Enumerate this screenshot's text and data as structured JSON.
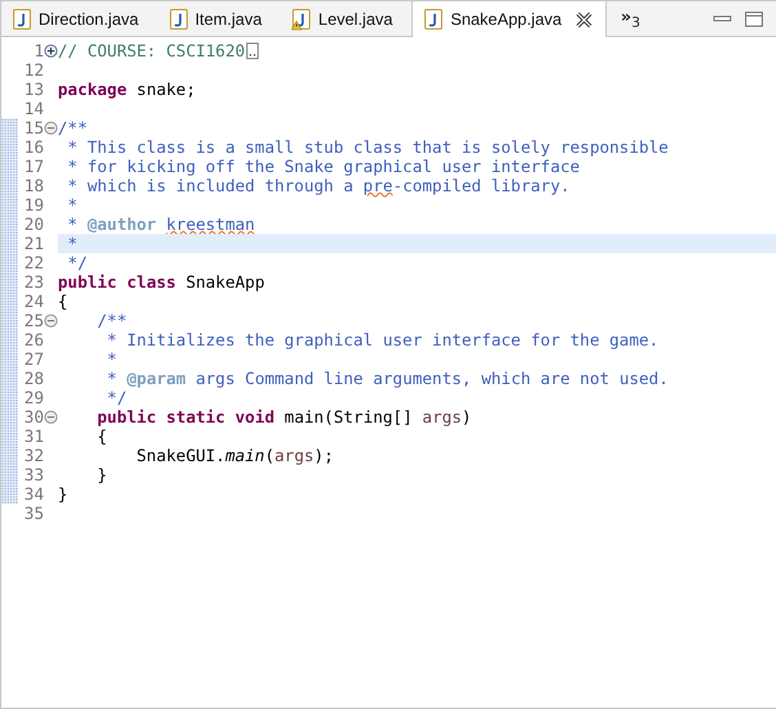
{
  "tabs": [
    {
      "label": "Direction.java",
      "selected": false,
      "warning": false,
      "closable": false
    },
    {
      "label": "Item.java",
      "selected": false,
      "warning": false,
      "closable": false
    },
    {
      "label": "Level.java",
      "selected": false,
      "warning": true,
      "closable": false
    },
    {
      "label": "SnakeApp.java",
      "selected": true,
      "warning": false,
      "closable": true
    }
  ],
  "overflow": {
    "chevron": "»",
    "count": "3"
  },
  "lines": [
    {
      "num": "1",
      "fold": {
        "expanded": false
      },
      "changed": false,
      "current": false,
      "folded_marker": true,
      "tokens": [
        {
          "t": "// COURSE: CSCI1620",
          "kind": "comment"
        }
      ]
    },
    {
      "num": "12",
      "changed": false,
      "current": false
    },
    {
      "num": "13",
      "changed": false,
      "current": false,
      "tokens": [
        {
          "t": "package",
          "kind": "keyword"
        },
        {
          "t": " snake;",
          "kind": "plain"
        }
      ]
    },
    {
      "num": "14",
      "changed": false,
      "current": false
    },
    {
      "num": "15",
      "fold": {
        "expanded": true
      },
      "changed": true,
      "current": false,
      "tokens": [
        {
          "t": "/**",
          "kind": "javadoc"
        }
      ]
    },
    {
      "num": "16",
      "changed": true,
      "current": false,
      "tokens": [
        {
          "t": " * This class is a small stub class that is solely responsible",
          "kind": "javadoc"
        }
      ]
    },
    {
      "num": "17",
      "changed": true,
      "current": false,
      "tokens": [
        {
          "t": " * for kicking off the Snake graphical user interface",
          "kind": "javadoc"
        }
      ]
    },
    {
      "num": "18",
      "changed": true,
      "current": false,
      "tokens": [
        {
          "t": " * which is included through a ",
          "kind": "javadoc"
        },
        {
          "t": "pre",
          "kind": "javadoc",
          "squiggle": true
        },
        {
          "t": "-compiled library.",
          "kind": "javadoc"
        }
      ]
    },
    {
      "num": "19",
      "changed": true,
      "current": false,
      "tokens": [
        {
          "t": " *",
          "kind": "javadoc"
        }
      ]
    },
    {
      "num": "20",
      "changed": true,
      "current": false,
      "tokens": [
        {
          "t": " * ",
          "kind": "javadoc"
        },
        {
          "t": "@author ",
          "kind": "tag"
        },
        {
          "t": "kreestman",
          "kind": "javadoc",
          "squiggle": true
        }
      ]
    },
    {
      "num": "21",
      "changed": true,
      "current": true,
      "tokens": [
        {
          "t": " *",
          "kind": "javadoc"
        }
      ]
    },
    {
      "num": "22",
      "changed": true,
      "current": false,
      "tokens": [
        {
          "t": " */",
          "kind": "javadoc"
        }
      ]
    },
    {
      "num": "23",
      "changed": true,
      "current": false,
      "tokens": [
        {
          "t": "public ",
          "kind": "keyword"
        },
        {
          "t": "class",
          "kind": "keyword"
        },
        {
          "t": " SnakeApp",
          "kind": "plain"
        }
      ]
    },
    {
      "num": "24",
      "changed": true,
      "current": false,
      "tokens": [
        {
          "t": "{",
          "kind": "plain"
        }
      ]
    },
    {
      "num": "25",
      "fold": {
        "expanded": true
      },
      "changed": true,
      "current": false,
      "tokens": [
        {
          "t": "    /**",
          "kind": "javadoc"
        }
      ]
    },
    {
      "num": "26",
      "changed": true,
      "current": false,
      "tokens": [
        {
          "t": "     * Initializes the graphical user interface for the game.",
          "kind": "javadoc"
        }
      ]
    },
    {
      "num": "27",
      "changed": true,
      "current": false,
      "tokens": [
        {
          "t": "     *",
          "kind": "javadoc"
        }
      ]
    },
    {
      "num": "28",
      "changed": true,
      "current": false,
      "tokens": [
        {
          "t": "     * ",
          "kind": "javadoc"
        },
        {
          "t": "@param",
          "kind": "tag"
        },
        {
          "t": " args Command line arguments, which are not used.",
          "kind": "javadoc"
        }
      ]
    },
    {
      "num": "29",
      "changed": true,
      "current": false,
      "tokens": [
        {
          "t": "     */",
          "kind": "javadoc"
        }
      ]
    },
    {
      "num": "30",
      "fold": {
        "expanded": true
      },
      "changed": true,
      "current": false,
      "tokens": [
        {
          "t": "    public ",
          "kind": "keyword"
        },
        {
          "t": "static ",
          "kind": "keyword"
        },
        {
          "t": "void",
          "kind": "keyword"
        },
        {
          "t": " main(String[] ",
          "kind": "plain"
        },
        {
          "t": "args",
          "kind": "param"
        },
        {
          "t": ")",
          "kind": "plain"
        }
      ]
    },
    {
      "num": "31",
      "changed": true,
      "current": false,
      "tokens": [
        {
          "t": "    {",
          "kind": "plain"
        }
      ]
    },
    {
      "num": "32",
      "changed": true,
      "current": false,
      "tokens": [
        {
          "t": "        SnakeGUI.",
          "kind": "plain"
        },
        {
          "t": "main",
          "kind": "static-call"
        },
        {
          "t": "(",
          "kind": "plain"
        },
        {
          "t": "args",
          "kind": "param"
        },
        {
          "t": ");",
          "kind": "plain"
        }
      ]
    },
    {
      "num": "33",
      "changed": true,
      "current": false,
      "tokens": [
        {
          "t": "    }",
          "kind": "plain"
        }
      ]
    },
    {
      "num": "34",
      "changed": true,
      "current": false,
      "tokens": [
        {
          "t": "}",
          "kind": "plain"
        }
      ]
    },
    {
      "num": "35",
      "changed": false,
      "current": false
    }
  ]
}
